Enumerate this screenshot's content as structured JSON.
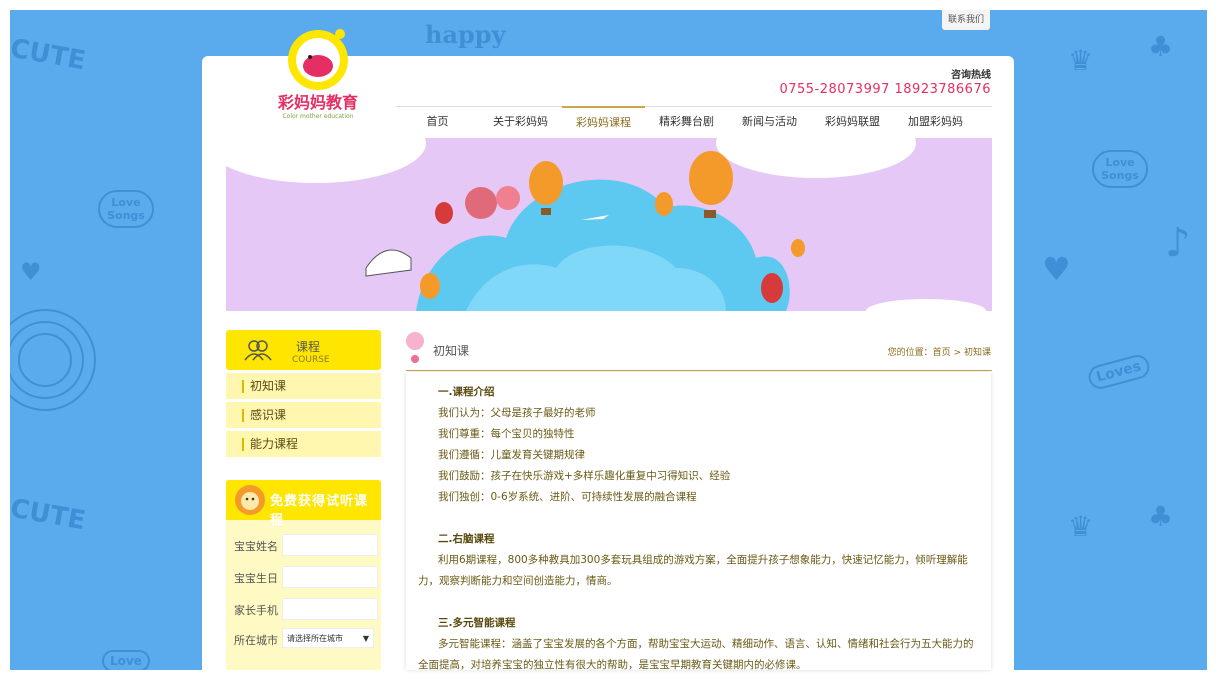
{
  "header": {
    "contact_tab": "联系我们",
    "hotline_title": "咨询热线",
    "hotline_numbers": "0755-28073997 18923786676",
    "logo_text": "彩妈妈教育",
    "logo_subtext": "Color mother education"
  },
  "nav": {
    "items": [
      "首页",
      "关于彩妈妈",
      "彩妈妈课程",
      "精彩舞台剧",
      "新闻与活动",
      "彩妈妈联盟",
      "加盟彩妈妈"
    ],
    "active_index": 2
  },
  "sidebar": {
    "title": "课程",
    "subtitle": "COURSE",
    "items": [
      "初知课",
      "感识课",
      "能力课程"
    ]
  },
  "trial": {
    "title": "免费获得试听课程",
    "fields": [
      "宝宝姓名",
      "宝宝生日",
      "家长手机",
      "所在城市"
    ],
    "city_placeholder": "请选择所在城市"
  },
  "content": {
    "title": "初知课",
    "breadcrumb_prefix": "您的位置：",
    "breadcrumb_home": "首页",
    "breadcrumb_sep": ">",
    "breadcrumb_current": "初知课",
    "sec1_title": "一.课程介绍",
    "sec1_lines": [
      "我们认为：父母是孩子最好的老师",
      "我们尊重：每个宝贝的独特性",
      "我们遵循：儿童发育关键期规律",
      "我们鼓励：孩子在快乐游戏+多样乐趣化重复中习得知识、经验",
      "我们独创：0-6岁系统、进阶、可持续性发展的融合课程"
    ],
    "sec2_title": "二.右脑课程",
    "sec2_text": "利用6期课程，800多种教具加300多套玩具组成的游戏方案，全面提升孩子想象能力，快速记忆能力，倾听理解能力，观察判断能力和空间创造能力，情商。",
    "sec3_title": "三.多元智能课程",
    "sec3_text": "多元智能课程：涵盖了宝宝发展的各个方面，帮助宝宝大运动、精细动作、语言、认知、情绪和社会行为五大能力的全面提高，对培养宝宝的独立性有很大的帮助，是宝宝早期教育关键期内的必修课。"
  },
  "decor": {
    "doodle_words": [
      "CUTE",
      "happy",
      "Love Songs",
      "Loves",
      "CUTE",
      "Love Songs",
      "Love"
    ]
  },
  "colors": {
    "background": "#5aabee",
    "accent": "#ffe600",
    "hotline": "#e52e64",
    "gold": "#c9a84a"
  }
}
